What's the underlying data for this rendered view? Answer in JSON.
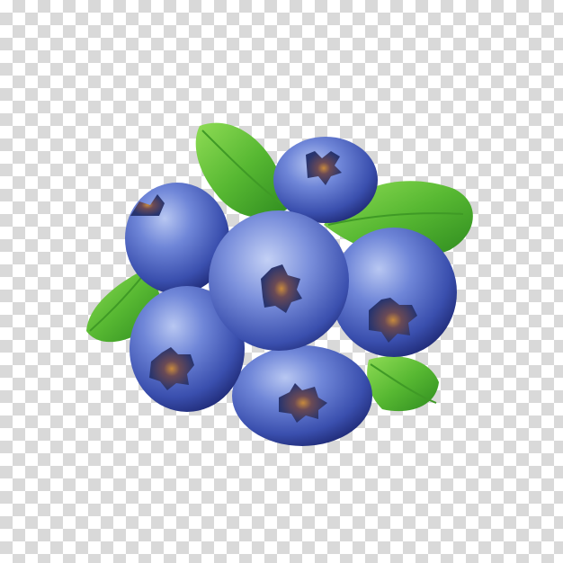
{
  "image": {
    "subject_icon": "blueberry-cluster-icon",
    "background": "transparency-checkerboard",
    "colors": {
      "checker_dark": "#d9d9d9",
      "checker_light": "#ffffff",
      "berry_dark": "#1f2c7a",
      "berry_mid": "#3f56b8",
      "berry_light": "#8aa0e6",
      "leaf_dark": "#2e8b1f",
      "leaf_light": "#7ccf45",
      "calyx": "#27346f",
      "calyx_inner": "#b07a3a"
    }
  }
}
